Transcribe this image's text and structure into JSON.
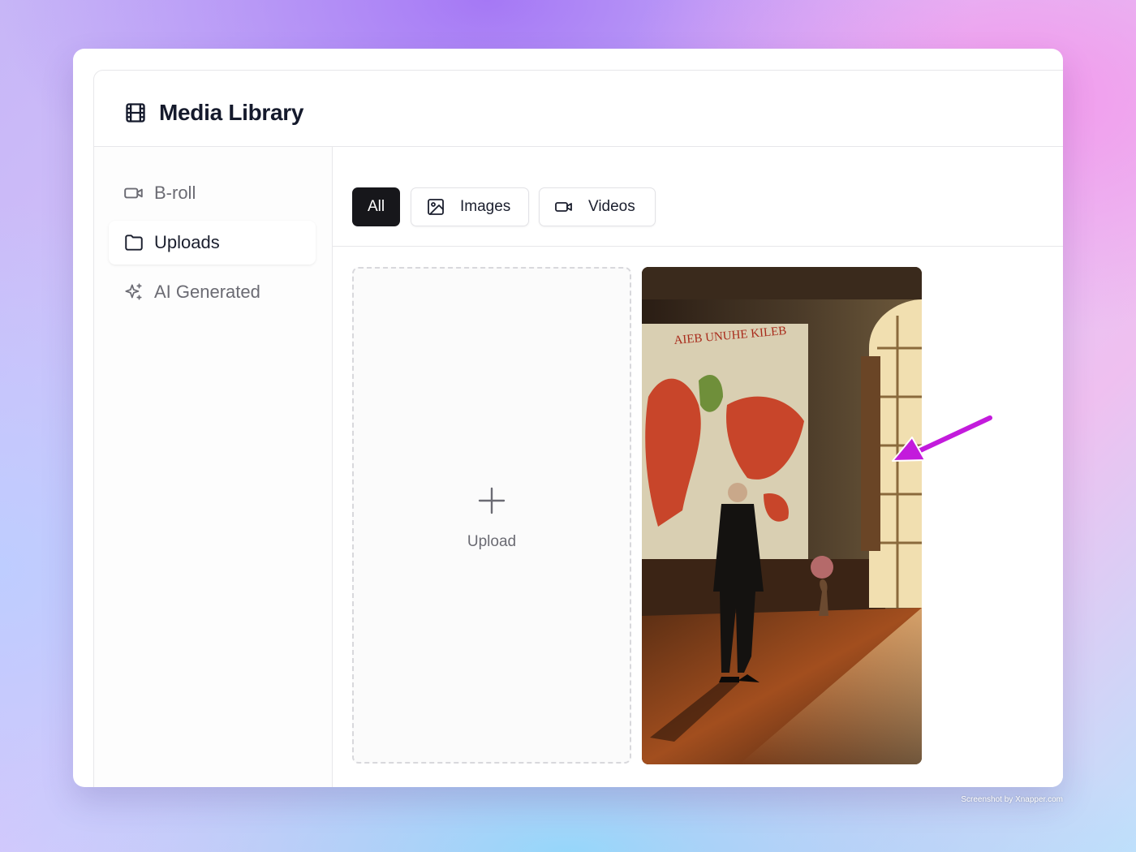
{
  "app": {
    "title": "Media Library",
    "logo_icon": "film-icon"
  },
  "sidebar": {
    "items": [
      {
        "label": "B-roll",
        "icon": "video-camera-icon",
        "active": false
      },
      {
        "label": "Uploads",
        "icon": "folder-icon",
        "active": true
      },
      {
        "label": "AI Generated",
        "icon": "sparkles-icon",
        "active": false
      }
    ]
  },
  "filters": {
    "tabs": [
      {
        "label": "All",
        "active": true
      },
      {
        "label": "Images",
        "icon": "image-icon",
        "active": false
      },
      {
        "label": "Videos",
        "icon": "video-camera-icon",
        "active": false
      }
    ]
  },
  "upload": {
    "label": "Upload",
    "icon": "plus-icon"
  },
  "media": {
    "items": [
      {
        "type": "image",
        "description_icon": "photo-thumbnail",
        "map_caption": "AIEB UNUHE KILEB"
      }
    ]
  },
  "annotation": {
    "arrow_color": "#c31bdc"
  },
  "footer": {
    "credit": "Screenshot by Xnapper.com"
  },
  "colors": {
    "active_tab_bg": "#17171b",
    "title_color": "#151a2c"
  }
}
